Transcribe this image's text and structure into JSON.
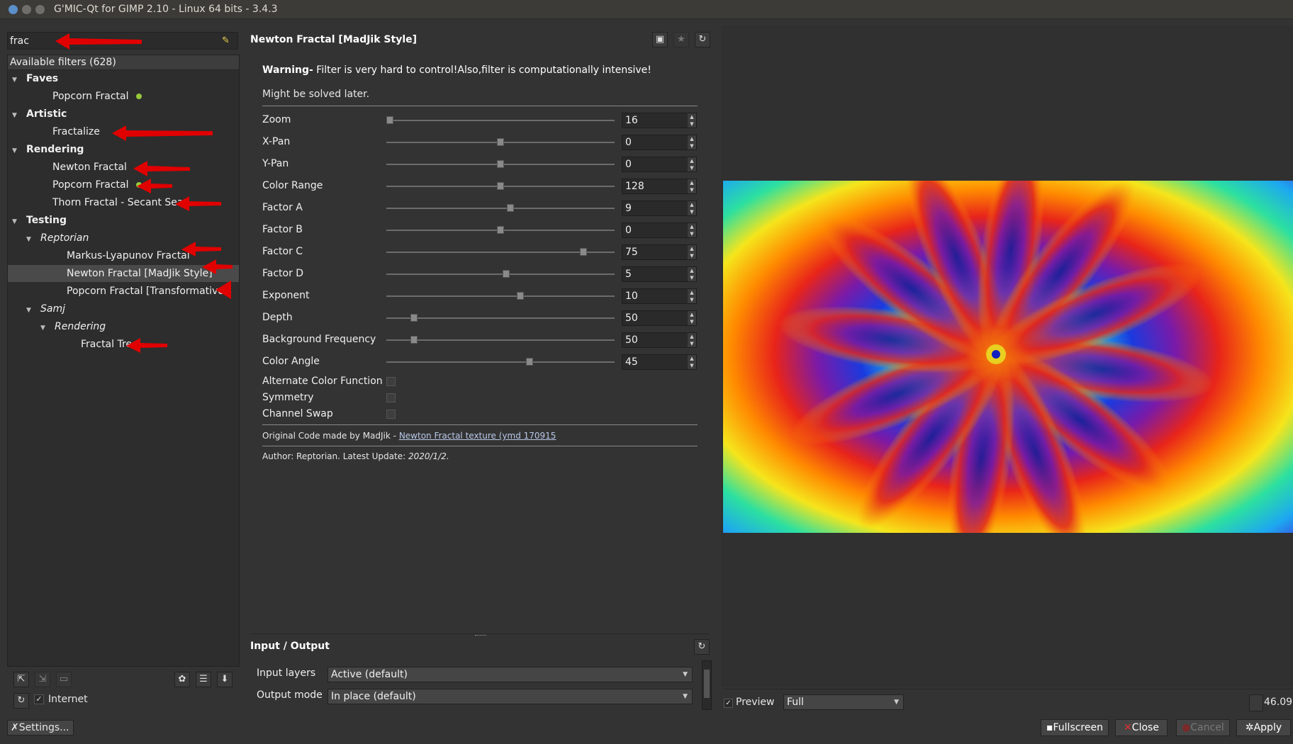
{
  "window": {
    "title": "G'MIC-Qt for GIMP 2.10 - Linux 64 bits - 3.4.3"
  },
  "search": {
    "value": "frac",
    "clear_icon": "broom-icon"
  },
  "filters": {
    "header": "Available filters (628)",
    "tree": [
      {
        "label": "Faves",
        "kind": "category",
        "expanded": true,
        "indent": 0
      },
      {
        "label": "Popcorn Fractal",
        "kind": "filter",
        "indent": 1,
        "fave": true
      },
      {
        "label": "Artistic",
        "kind": "category",
        "expanded": true,
        "indent": 0
      },
      {
        "label": "Fractalize",
        "kind": "filter",
        "indent": 1
      },
      {
        "label": "Rendering",
        "kind": "category",
        "expanded": true,
        "indent": 0
      },
      {
        "label": "Newton Fractal",
        "kind": "filter",
        "indent": 1
      },
      {
        "label": "Popcorn Fractal",
        "kind": "filter",
        "indent": 1,
        "fave": true
      },
      {
        "label": "Thorn Fractal - Secant Sea",
        "kind": "filter",
        "indent": 1
      },
      {
        "label": "Testing",
        "kind": "category",
        "expanded": true,
        "indent": 0
      },
      {
        "label": "Reptorian",
        "kind": "subcategory",
        "expanded": true,
        "indent": 1
      },
      {
        "label": "Markus-Lyapunov Fractal",
        "kind": "filter",
        "indent": 2
      },
      {
        "label": "Newton Fractal [MadJik Style]",
        "kind": "filter",
        "indent": 2,
        "selected": true
      },
      {
        "label": "Popcorn Fractal [Transformative]",
        "kind": "filter",
        "indent": 2
      },
      {
        "label": "Samj",
        "kind": "subcategory",
        "expanded": true,
        "indent": 1
      },
      {
        "label": "Rendering",
        "kind": "subcategory",
        "expanded": true,
        "indent": 2
      },
      {
        "label": "Fractal Tree",
        "kind": "filter",
        "indent": 3
      }
    ],
    "internet_label": "Internet",
    "settings_label": "Settings..."
  },
  "filter": {
    "title": "Newton Fractal [MadJik Style]",
    "warning_bold": "Warning-",
    "warning_text": " Filter is very hard to control!Also,filter is computationally intensive!",
    "warning_line2": "Might be solved later.",
    "params": [
      {
        "label": "Zoom",
        "value": "16",
        "fraction": 0.0
      },
      {
        "label": "X-Pan",
        "value": "0",
        "fraction": 0.5
      },
      {
        "label": "Y-Pan",
        "value": "0",
        "fraction": 0.5
      },
      {
        "label": "Color Range",
        "value": "128",
        "fraction": 0.5
      },
      {
        "label": "Factor A",
        "value": "9",
        "fraction": 0.545
      },
      {
        "label": "Factor B",
        "value": "0",
        "fraction": 0.5
      },
      {
        "label": "Factor C",
        "value": "75",
        "fraction": 0.875
      },
      {
        "label": "Factor D",
        "value": "5",
        "fraction": 0.525
      },
      {
        "label": "Exponent",
        "value": "10",
        "fraction": 0.59
      },
      {
        "label": "Depth",
        "value": "50",
        "fraction": 0.11
      },
      {
        "label": "Background Frequency",
        "value": "50",
        "fraction": 0.11
      },
      {
        "label": "Color Angle",
        "value": "45",
        "fraction": 0.63
      }
    ],
    "checkboxes": [
      {
        "label": "Alternate Color Function",
        "checked": false
      },
      {
        "label": "Symmetry",
        "checked": false
      },
      {
        "label": "Channel Swap",
        "checked": false
      }
    ],
    "credit_prefix": "Original Code made by MadJik - ",
    "credit_link": "Newton Fractal texture (ymd 170915",
    "author_prefix": "Author: Reptorian. Latest Update: ",
    "author_date": "2020/1/2."
  },
  "io": {
    "title": "Input / Output",
    "input_label": "Input layers",
    "input_value": "Active (default)",
    "output_label": "Output mode",
    "output_value": "In place (default)"
  },
  "preview": {
    "checkbox_label": "Preview",
    "checked": true,
    "mode_value": "Full",
    "zoom_value": "46.09"
  },
  "buttons": {
    "fullscreen": "Fullscreen",
    "close": "Close",
    "cancel": "Cancel",
    "apply": "Apply"
  },
  "colors": {
    "annotation_arrow": "#e00000",
    "fave_dot": "#98c83c"
  }
}
